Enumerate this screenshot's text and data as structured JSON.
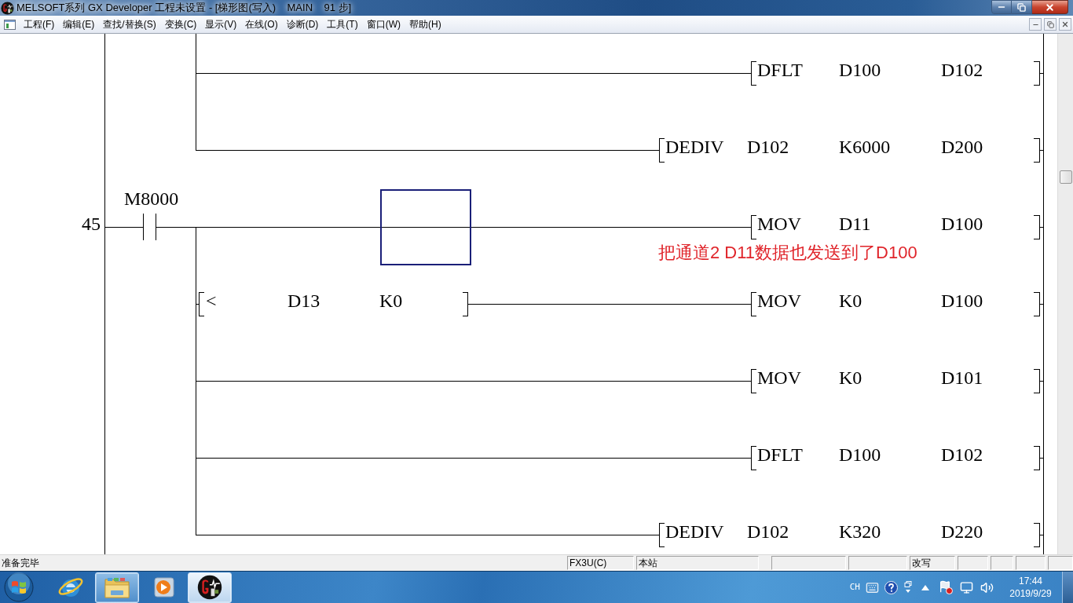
{
  "window": {
    "title": "MELSOFT系列 GX Developer 工程未设置 - [梯形图(写入)    MAIN    91 步]"
  },
  "menu": [
    "工程(F)",
    "编辑(E)",
    "查找/替换(S)",
    "变换(C)",
    "显示(V)",
    "在线(O)",
    "诊断(D)",
    "工具(T)",
    "窗口(W)",
    "帮助(H)"
  ],
  "ladder": {
    "rungs": [
      {
        "outputs": [
          {
            "instruction": [
              "DFLT",
              "D100",
              "D102"
            ],
            "cursor": false
          },
          {
            "instruction": [
              "DEDIV",
              "D102",
              "K6000",
              "D200"
            ],
            "cursor": false
          }
        ]
      },
      {
        "step": "45",
        "contact": {
          "device": "M8000",
          "kind": "normally_open"
        },
        "outputs": [
          {
            "instruction": [
              "MOV",
              "D11",
              "D100"
            ],
            "cursor": true,
            "note": "把通道2 D11数据也发送到了D100"
          },
          {
            "condition": [
              "<",
              "D13",
              "K0"
            ],
            "instruction": [
              "MOV",
              "K0",
              "D100"
            ],
            "cursor": false
          },
          {
            "instruction": [
              "MOV",
              "K0",
              "D101"
            ],
            "cursor": false
          },
          {
            "instruction": [
              "DFLT",
              "D100",
              "D102"
            ],
            "cursor": false
          },
          {
            "instruction": [
              "DEDIV",
              "D102",
              "K320",
              "D220"
            ],
            "cursor": false
          }
        ]
      }
    ]
  },
  "status_bar": {
    "message": "准备完毕",
    "plc_type": "FX3U(C)",
    "station": "本站",
    "mode": "改写"
  },
  "taskbar": {
    "apps": [
      {
        "kind": "browser",
        "running": false,
        "selected": false
      },
      {
        "kind": "folder",
        "running": true,
        "selected": false
      },
      {
        "kind": "media",
        "running": false,
        "selected": false
      },
      {
        "kind": "plc",
        "running": true,
        "selected": true
      }
    ],
    "language": "CH",
    "time": "17:44",
    "date": "2019/9/29"
  }
}
